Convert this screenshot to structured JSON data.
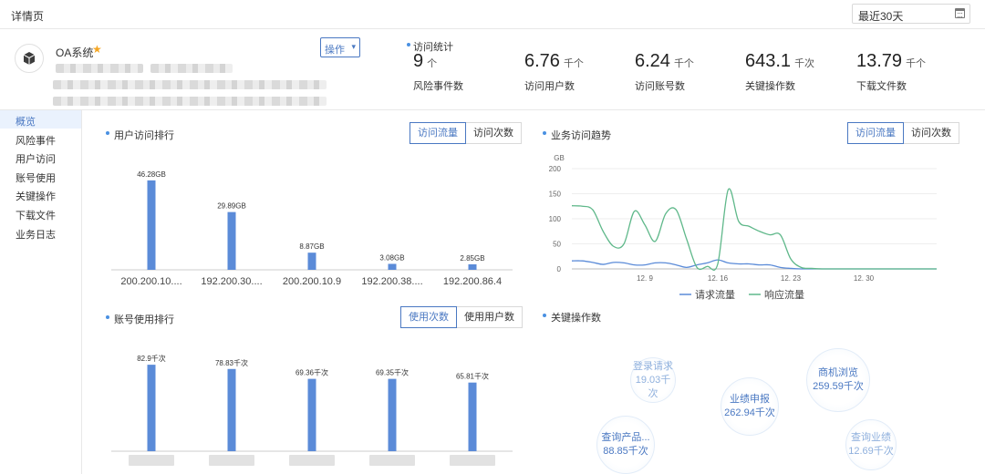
{
  "page": {
    "title": "详情页"
  },
  "date_filter": {
    "value": "最近30天",
    "icon": "calendar-icon"
  },
  "app": {
    "name": "OA系统",
    "starred": true,
    "action_label": "操作",
    "logo_icon": "cube-icon"
  },
  "stats": {
    "heading": "访问统计",
    "items": [
      {
        "value": "9",
        "unit": "个",
        "label": "风险事件数"
      },
      {
        "value": "6.76",
        "unit": "千个",
        "label": "访问用户数"
      },
      {
        "value": "6.24",
        "unit": "千个",
        "label": "访问账号数"
      },
      {
        "value": "643.1",
        "unit": "千次",
        "label": "关键操作数"
      },
      {
        "value": "13.79",
        "unit": "千个",
        "label": "下载文件数"
      }
    ]
  },
  "sidebar": {
    "items": [
      "概览",
      "风险事件",
      "用户访问",
      "账号使用",
      "关键操作",
      "下载文件",
      "业务日志"
    ],
    "active_index": 0
  },
  "user_rank": {
    "title": "用户访问排行",
    "toggle": [
      "访问流量",
      "访问次数"
    ],
    "active": 0
  },
  "business_trend": {
    "title": "业务访问趋势",
    "toggle": [
      "访问流量",
      "访问次数"
    ],
    "active": 0
  },
  "account_rank": {
    "title": "账号使用排行",
    "toggle": [
      "使用次数",
      "使用用户数"
    ],
    "active": 0
  },
  "key_ops": {
    "title": "关键操作数",
    "bubbles": [
      {
        "name": "登录请求",
        "value": "19.03千次"
      },
      {
        "name": "业绩申报",
        "value": "262.94千次"
      },
      {
        "name": "商机浏览",
        "value": "259.59千次"
      },
      {
        "name": "查询产品...",
        "value": "88.85千次"
      },
      {
        "name": "查询业绩",
        "value": "12.69千次"
      }
    ]
  },
  "chart_data": [
    {
      "type": "bar",
      "categories": [
        "200.200.10....",
        "192.200.30....",
        "200.200.10.9",
        "192.200.38....",
        "192.200.86.4"
      ],
      "values": [
        46.28,
        29.89,
        8.87,
        3.08,
        2.85
      ],
      "value_labels": [
        "46.28GB",
        "29.89GB",
        "8.87GB",
        "3.08GB",
        "2.85GB"
      ],
      "ylim": [
        0,
        50
      ],
      "color": "#5b8bd8"
    },
    {
      "type": "line",
      "ylabel": "GB",
      "ylim": [
        0,
        200
      ],
      "yticks": [
        0,
        50,
        100,
        150,
        200
      ],
      "xlim": [
        0,
        35
      ],
      "xticks": [
        {
          "x": 7,
          "label": "12. 9"
        },
        {
          "x": 14,
          "label": "12. 16"
        },
        {
          "x": 21,
          "label": "12. 23"
        },
        {
          "x": 28,
          "label": "12. 30"
        }
      ],
      "legend_position": "bottom",
      "series": [
        {
          "name": "请求流量",
          "color": "#5b8bd8",
          "points": [
            [
              0,
              16
            ],
            [
              1,
              16
            ],
            [
              2,
              13
            ],
            [
              3,
              9
            ],
            [
              4,
              13
            ],
            [
              5,
              12
            ],
            [
              6,
              8
            ],
            [
              7,
              8
            ],
            [
              8,
              12
            ],
            [
              9,
              12
            ],
            [
              10,
              8
            ],
            [
              11,
              3
            ],
            [
              12,
              8
            ],
            [
              13,
              12
            ],
            [
              14,
              18
            ],
            [
              15,
              12
            ],
            [
              16,
              10
            ],
            [
              17,
              10
            ],
            [
              18,
              8
            ],
            [
              19,
              8
            ],
            [
              20,
              3
            ],
            [
              21,
              1
            ],
            [
              22,
              0
            ],
            [
              23,
              0
            ],
            [
              24,
              0
            ],
            [
              25,
              0
            ],
            [
              26,
              0
            ],
            [
              27,
              0
            ],
            [
              28,
              0
            ],
            [
              29,
              0
            ],
            [
              30,
              0
            ],
            [
              31,
              0
            ],
            [
              32,
              0
            ],
            [
              33,
              0
            ],
            [
              34,
              0
            ],
            [
              35,
              0
            ]
          ]
        },
        {
          "name": "响应流量",
          "color": "#5fb88a",
          "points": [
            [
              0,
              126
            ],
            [
              1,
              125
            ],
            [
              2,
              118
            ],
            [
              3,
              75
            ],
            [
              4,
              45
            ],
            [
              5,
              50
            ],
            [
              6,
              115
            ],
            [
              7,
              88
            ],
            [
              8,
              55
            ],
            [
              9,
              110
            ],
            [
              10,
              118
            ],
            [
              11,
              60
            ],
            [
              12,
              3
            ],
            [
              13,
              5
            ],
            [
              14,
              10
            ],
            [
              15,
              158
            ],
            [
              16,
              95
            ],
            [
              17,
              85
            ],
            [
              18,
              75
            ],
            [
              19,
              68
            ],
            [
              20,
              68
            ],
            [
              21,
              20
            ],
            [
              22,
              3
            ],
            [
              23,
              1
            ],
            [
              24,
              0
            ],
            [
              25,
              0
            ],
            [
              26,
              0
            ],
            [
              27,
              0
            ],
            [
              28,
              0
            ],
            [
              29,
              0
            ],
            [
              30,
              0
            ],
            [
              31,
              0
            ],
            [
              32,
              0
            ],
            [
              33,
              0
            ],
            [
              34,
              0
            ],
            [
              35,
              0
            ]
          ]
        }
      ]
    },
    {
      "type": "bar",
      "categories": [
        "",
        "",
        "",
        "",
        ""
      ],
      "values": [
        82.9,
        78.83,
        69.36,
        69.35,
        65.81
      ],
      "value_labels": [
        "82.9千次",
        "78.83千次",
        "69.36千次",
        "69.35千次",
        "65.81千次"
      ],
      "ylim": [
        0,
        90
      ],
      "color": "#5b8bd8"
    }
  ]
}
